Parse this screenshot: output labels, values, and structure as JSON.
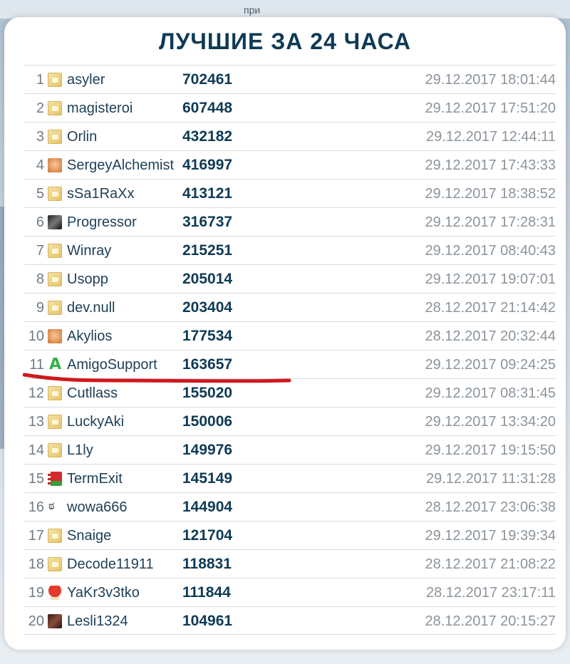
{
  "background_hint": "при",
  "title": "ЛУЧШИЕ ЗА 24 ЧАСА",
  "rows": [
    {
      "rank": "1",
      "name": "asyler",
      "score": "702461",
      "date": "29.12.2017 18:01:44",
      "avatar": "default"
    },
    {
      "rank": "2",
      "name": "magisteroi",
      "score": "607448",
      "date": "29.12.2017 17:51:20",
      "avatar": "default"
    },
    {
      "rank": "3",
      "name": "Orlin",
      "score": "432182",
      "date": "29.12.2017 12:44:11",
      "avatar": "default"
    },
    {
      "rank": "4",
      "name": "SergeyAlchemist",
      "score": "416997",
      "date": "29.12.2017 17:43:33",
      "avatar": "fox"
    },
    {
      "rank": "5",
      "name": "sSa1RaXx",
      "score": "413121",
      "date": "29.12.2017 18:38:52",
      "avatar": "default"
    },
    {
      "rank": "6",
      "name": "Progressor",
      "score": "316737",
      "date": "29.12.2017 17:28:31",
      "avatar": "dark"
    },
    {
      "rank": "7",
      "name": "Winray",
      "score": "215251",
      "date": "29.12.2017 08:40:43",
      "avatar": "default"
    },
    {
      "rank": "8",
      "name": "Usopp",
      "score": "205014",
      "date": "29.12.2017 19:07:01",
      "avatar": "default"
    },
    {
      "rank": "9",
      "name": "dev.null",
      "score": "203404",
      "date": "28.12.2017 21:14:42",
      "avatar": "default"
    },
    {
      "rank": "10",
      "name": "Akylios",
      "score": "177534",
      "date": "28.12.2017 20:32:44",
      "avatar": "fox"
    },
    {
      "rank": "11",
      "name": "AmigoSupport",
      "score": "163657",
      "date": "29.12.2017 09:24:25",
      "avatar": "amigo"
    },
    {
      "rank": "12",
      "name": "Cutllass",
      "score": "155020",
      "date": "29.12.2017 08:31:45",
      "avatar": "default"
    },
    {
      "rank": "13",
      "name": "LuckyAki",
      "score": "150006",
      "date": "29.12.2017 13:34:20",
      "avatar": "default"
    },
    {
      "rank": "14",
      "name": "L1ly",
      "score": "149976",
      "date": "29.12.2017 19:15:50",
      "avatar": "default"
    },
    {
      "rank": "15",
      "name": "TermExit",
      "score": "145149",
      "date": "29.12.2017 11:31:28",
      "avatar": "belarus"
    },
    {
      "rank": "16",
      "name": "wowa666",
      "score": "144904",
      "date": "28.12.2017 23:06:38",
      "avatar": "face"
    },
    {
      "rank": "17",
      "name": "Snaige",
      "score": "121704",
      "date": "29.12.2017 19:39:34",
      "avatar": "default"
    },
    {
      "rank": "18",
      "name": "Decode11911",
      "score": "118831",
      "date": "28.12.2017 21:08:22",
      "avatar": "default"
    },
    {
      "rank": "19",
      "name": "YaKr3v3tko",
      "score": "111844",
      "date": "28.12.2017 23:17:11",
      "avatar": "mushroom"
    },
    {
      "rank": "20",
      "name": "Lesli1324",
      "score": "104961",
      "date": "28.12.2017 20:15:27",
      "avatar": "lesli"
    }
  ],
  "amigo_glyph": "A",
  "face_glyph": "ಠ",
  "colors": {
    "title": "#0e3a55",
    "score": "#0e3a55",
    "date": "#8b949c",
    "underline": "#d0181c"
  }
}
